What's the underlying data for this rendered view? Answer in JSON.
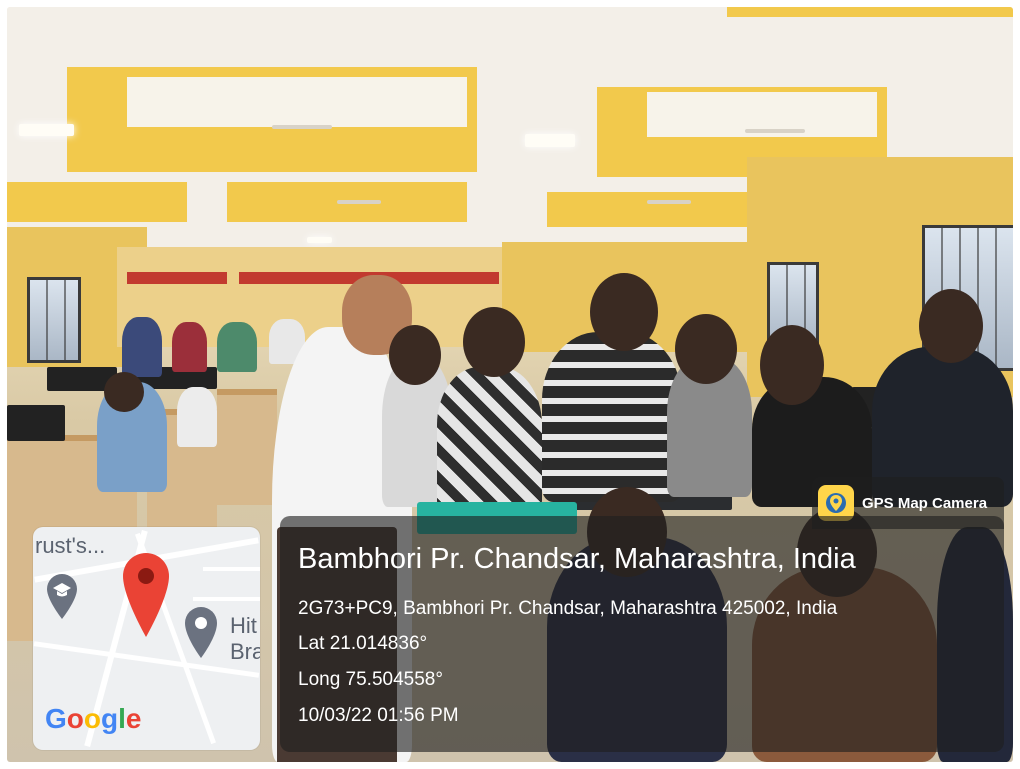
{
  "overlay": {
    "brand": {
      "label": "GPS Map Camera",
      "icon": "gps-map-camera-icon"
    },
    "title": "Bambhori Pr. Chandsar, Maharashtra, India",
    "address": "2G73+PC9, Bambhori Pr. Chandsar, Maharashtra 425002, India",
    "lat": "Lat 21.014836°",
    "long": "Long 75.504558°",
    "datetime": "10/03/22 01:56 PM"
  },
  "map": {
    "label_left": "rust's...",
    "label_right_1": "Hit",
    "label_right_2": "Bra",
    "logo": "Google",
    "pin_color": "#EA4335",
    "icons": [
      "location-pin-icon",
      "school-marker-icon",
      "place-marker-icon"
    ]
  },
  "colors": {
    "wall": "#e9c45d",
    "panel": "rgba(30,30,30,0.62)"
  }
}
